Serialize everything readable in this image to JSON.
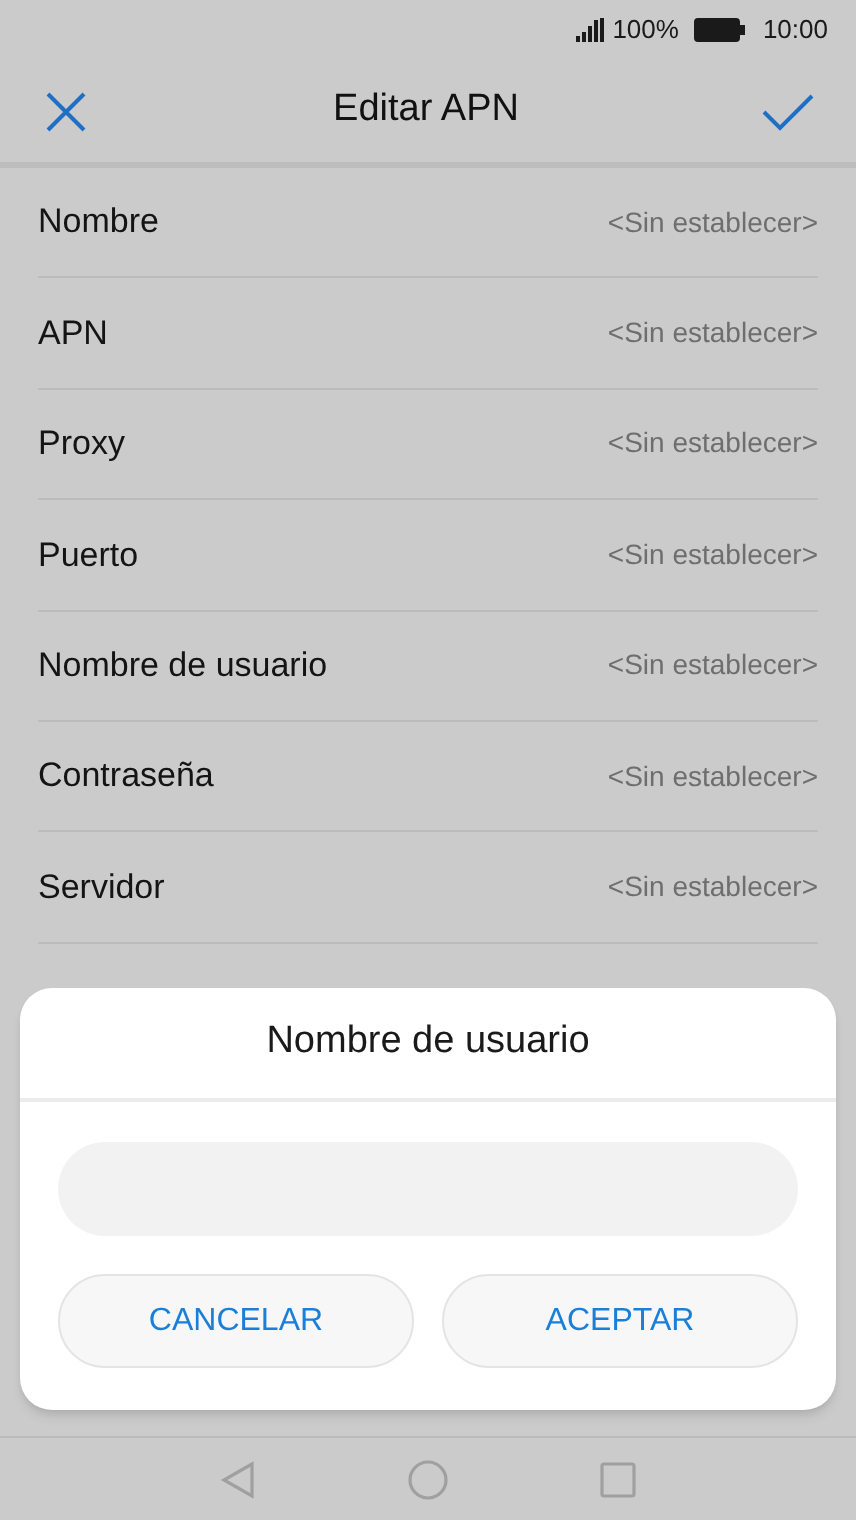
{
  "status_bar": {
    "battery": "100%",
    "time": "10:00"
  },
  "toolbar": {
    "title": "Editar APN"
  },
  "rows": [
    {
      "label": "Nombre",
      "value": "<Sin establecer>"
    },
    {
      "label": "APN",
      "value": "<Sin establecer>"
    },
    {
      "label": "Proxy",
      "value": "<Sin establecer>"
    },
    {
      "label": "Puerto",
      "value": "<Sin establecer>"
    },
    {
      "label": "Nombre de usuario",
      "value": "<Sin establecer>"
    },
    {
      "label": "Contraseña",
      "value": "<Sin establecer>"
    },
    {
      "label": "Servidor",
      "value": "<Sin establecer>"
    }
  ],
  "dialog": {
    "title": "Nombre de usuario",
    "buttons": [
      "CANCELAR",
      "ACEPTAR"
    ]
  }
}
